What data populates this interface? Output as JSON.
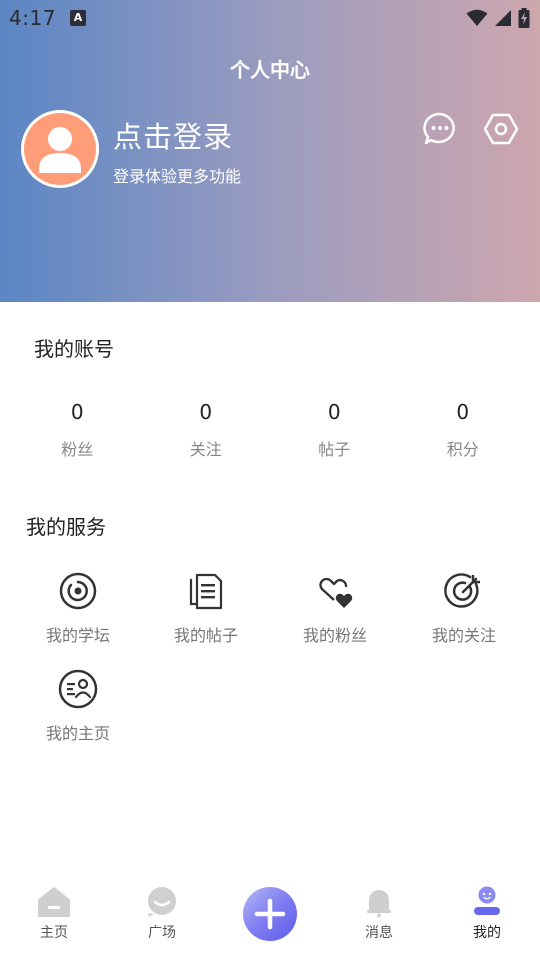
{
  "status_bar": {
    "time": "4:17",
    "notification_glyph": "A"
  },
  "header": {
    "title": "个人中心",
    "login_title": "点击登录",
    "login_subtitle": "登录体验更多功能"
  },
  "account": {
    "title": "我的账号",
    "stats": [
      {
        "value": "0",
        "label": "粉丝"
      },
      {
        "value": "0",
        "label": "关注"
      },
      {
        "value": "0",
        "label": "帖子"
      },
      {
        "value": "0",
        "label": "积分"
      }
    ]
  },
  "services": {
    "title": "我的服务",
    "items": [
      {
        "label": "我的学坛",
        "icon": "forum-icon"
      },
      {
        "label": "我的帖子",
        "icon": "documents-icon"
      },
      {
        "label": "我的粉丝",
        "icon": "hearts-icon"
      },
      {
        "label": "我的关注",
        "icon": "target-icon"
      },
      {
        "label": "我的主页",
        "icon": "profile-card-icon"
      }
    ]
  },
  "tabbar": {
    "items": [
      {
        "label": "主页",
        "icon": "home-icon"
      },
      {
        "label": "广场",
        "icon": "square-icon"
      },
      {
        "label": "",
        "icon": "add-icon"
      },
      {
        "label": "消息",
        "icon": "message-icon"
      },
      {
        "label": "我的",
        "icon": "mine-icon",
        "active": true
      }
    ]
  },
  "colors": {
    "header_gradient_start": "#5b86c4",
    "header_gradient_end": "#cea6ae",
    "avatar_bg": "#ff9d78",
    "accent": "#6c6aee"
  }
}
